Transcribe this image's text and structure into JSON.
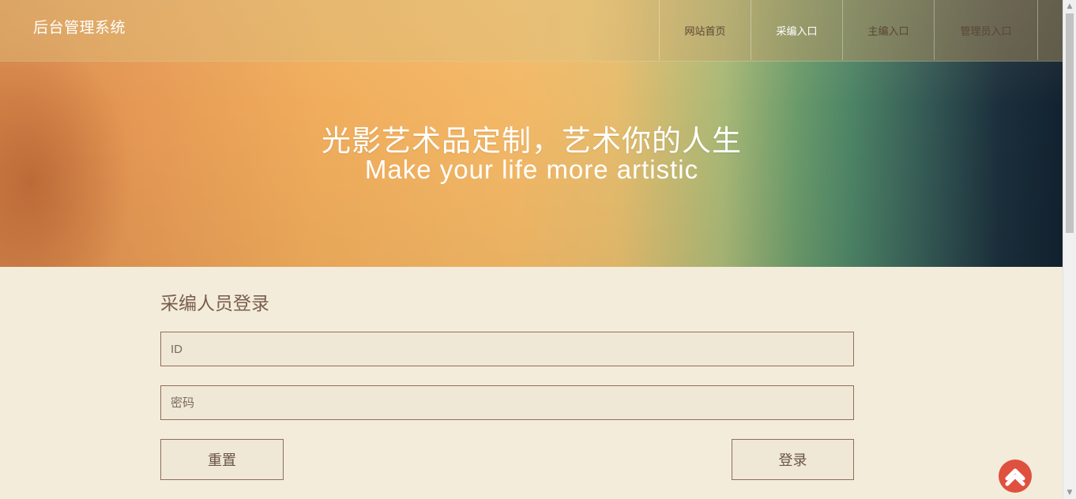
{
  "header": {
    "brand": "后台管理系统",
    "nav": [
      {
        "label": "网站首页"
      },
      {
        "label": "采编入口"
      },
      {
        "label": "主编入口"
      },
      {
        "label": "管理员入口"
      }
    ],
    "active_nav": "采编入口"
  },
  "hero": {
    "title": "光影艺术品定制，艺术你的人生",
    "subtitle": "Make your life more artistic"
  },
  "login": {
    "title": "采编人员登录",
    "id_placeholder": "ID",
    "password_placeholder": "密码",
    "reset_label": "重置",
    "submit_label": "登录"
  },
  "icons": {
    "back_to_top": "chevron-up-icon"
  },
  "colors": {
    "accent": "#e0503f",
    "page_background": "#f4ecda",
    "field_border": "#8f6e5a"
  }
}
